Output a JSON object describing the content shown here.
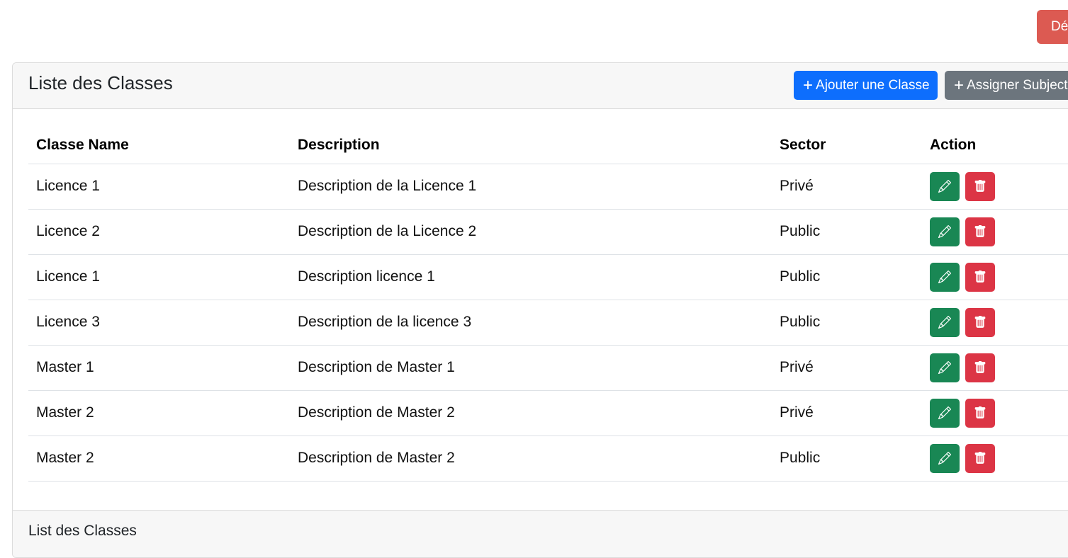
{
  "topbar": {
    "logout_label": "Déconnexion"
  },
  "card": {
    "title": "Liste des Classes",
    "add_button_label": "Ajouter une Classe",
    "assign_button_label": "Assigner Subjects",
    "footer_text": "List des Classes"
  },
  "table": {
    "headers": [
      "Classe Name",
      "Description",
      "Sector",
      "Action"
    ],
    "rows": [
      {
        "name": "Licence 1",
        "description": "Description de la Licence 1",
        "sector": "Privé"
      },
      {
        "name": "Licence 2",
        "description": "Description de la Licence 2",
        "sector": "Public"
      },
      {
        "name": "Licence 1",
        "description": "Description licence 1",
        "sector": "Public"
      },
      {
        "name": "Licence 3",
        "description": "Description de la licence 3",
        "sector": "Public"
      },
      {
        "name": "Master 1",
        "description": "Description de Master 1",
        "sector": "Privé"
      },
      {
        "name": "Master 2",
        "description": "Description de Master 2",
        "sector": "Privé"
      },
      {
        "name": "Master 2",
        "description": "Description de Master 2",
        "sector": "Public"
      }
    ]
  },
  "icons": {
    "plus": "plus-icon",
    "edit": "pencil-icon",
    "delete": "trash-icon"
  },
  "colors": {
    "primary": "#0d6efd",
    "secondary": "#6c757d",
    "success": "#198754",
    "danger": "#dc3545"
  }
}
